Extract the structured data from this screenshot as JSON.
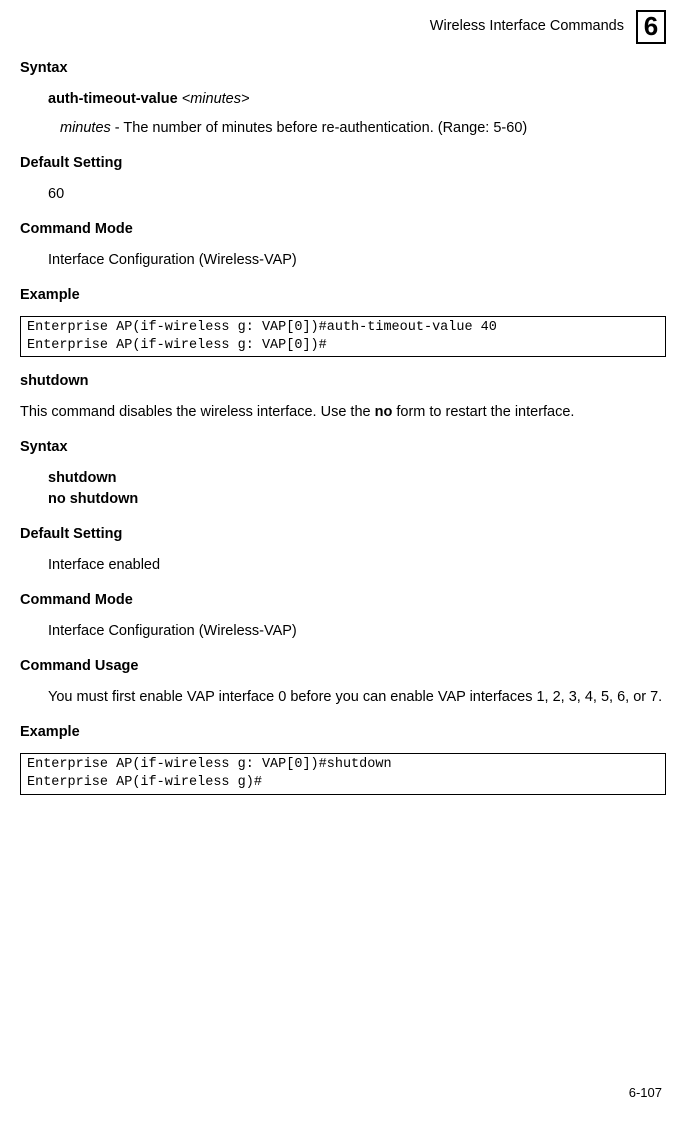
{
  "header": {
    "title": "Wireless Interface Commands",
    "chapter": "6"
  },
  "s1": {
    "heading": "Syntax",
    "cmd_prefix": "auth-timeout-value ",
    "cmd_arg": "<minutes>",
    "param_name": "minutes",
    "param_desc": " - The number of minutes before re-authentication. (Range: 5-60)"
  },
  "s2": {
    "heading": "Default Setting",
    "value": "60"
  },
  "s3": {
    "heading": "Command Mode",
    "value": "Interface Configuration (Wireless-VAP)"
  },
  "s4": {
    "heading": "Example",
    "code": "Enterprise AP(if-wireless g: VAP[0])#auth-timeout-value 40\nEnterprise AP(if-wireless g: VAP[0])#"
  },
  "s5": {
    "heading": "shutdown",
    "desc_a": "This command disables the wireless interface. Use the ",
    "desc_bold": "no",
    "desc_b": " form to restart the interface."
  },
  "s6": {
    "heading": "Syntax",
    "line1": "shutdown",
    "line2": "no shutdown"
  },
  "s7": {
    "heading": "Default Setting",
    "value": "Interface enabled"
  },
  "s8": {
    "heading": "Command Mode",
    "value": "Interface Configuration (Wireless-VAP)"
  },
  "s9": {
    "heading": "Command Usage",
    "value": "You must first enable VAP interface 0 before you can enable VAP interfaces 1, 2, 3, 4, 5, 6, or 7."
  },
  "s10": {
    "heading": "Example",
    "code": "Enterprise AP(if-wireless g: VAP[0])#shutdown\nEnterprise AP(if-wireless g)#"
  },
  "footer": {
    "page": "6-107"
  }
}
